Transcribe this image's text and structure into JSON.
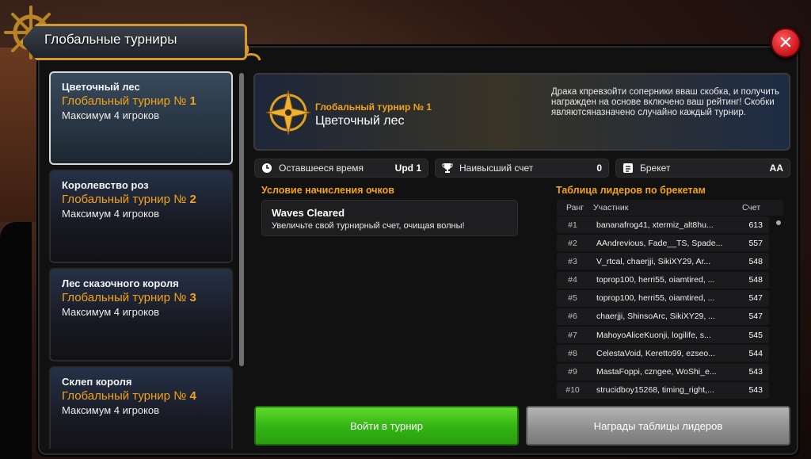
{
  "window": {
    "title": "Глобальные турниры"
  },
  "tournaments": [
    {
      "name": "Цветочный лес",
      "label": "Глобальный турнир №",
      "number": "1",
      "max": "Максимум 4 игроков"
    },
    {
      "name": "Королевство роз",
      "label": "Глобальный турнир №",
      "number": "2",
      "max": "Максимум 4 игроков"
    },
    {
      "name": "Лес сказочного короля",
      "label": "Глобальный турнир №",
      "number": "3",
      "max": "Максимум 4 игроков"
    },
    {
      "name": "Склеп короля",
      "label": "Глобальный турнир №",
      "number": "4",
      "max": "Максимум 4 игроков"
    }
  ],
  "hero": {
    "label": "Глобальный турнир № 1",
    "name": "Цветочный лес",
    "description": "Драка кпревзойти соперники вваш скобка, и получить награжден на основе включено ваш рейтинг! Скобки являютсяназначено случайно каждый турнир."
  },
  "stats": {
    "time": {
      "label": "Оставшееся время",
      "value": "Upd 1"
    },
    "highscore": {
      "label": "Наивысший счет",
      "value": "0"
    },
    "bracket": {
      "label": "Брекет",
      "value": "AA"
    }
  },
  "scoring": {
    "title": "Условие начисления очков",
    "condition_title": "Waves Cleared",
    "condition_desc": "Увеличьте свой турнирный счет, очищая волны!"
  },
  "leaderboard": {
    "title": "Таблица лидеров по брекетам",
    "col_rank": "Ранг",
    "col_participant": "Участник",
    "col_score": "Счет",
    "rows": [
      {
        "rank": "#1",
        "name": "bananafrog41, xtermiz_alt8hu...",
        "score": "613"
      },
      {
        "rank": "#2",
        "name": "AAndrevious, Fade__TS, Spade...",
        "score": "557"
      },
      {
        "rank": "#3",
        "name": "V_rtcal, chaerjji, SikiXY29, Ar...",
        "score": "548"
      },
      {
        "rank": "#4",
        "name": "toprop100, herri55, oiamtired, ...",
        "score": "548"
      },
      {
        "rank": "#5",
        "name": "toprop100, herri55, oiamtired, ...",
        "score": "547"
      },
      {
        "rank": "#6",
        "name": "chaerjji, ShinsoArc, SikiXY29, ...",
        "score": "547"
      },
      {
        "rank": "#7",
        "name": "MahoyoAliceKuonji, logilife, s...",
        "score": "545"
      },
      {
        "rank": "#8",
        "name": "CelestaVoid, Keretto99, ezseo...",
        "score": "544"
      },
      {
        "rank": "#9",
        "name": "MastaFoppi, czngee, WoShi_e...",
        "score": "543"
      },
      {
        "rank": "#10",
        "name": "strucidboy15268, timing_right,...",
        "score": "543"
      }
    ]
  },
  "buttons": {
    "enter": "Войти в турнир",
    "rewards": "Награды таблицы лидеров"
  },
  "colors": {
    "gold": "#f2a318",
    "enter_green": "#32b314",
    "close_red": "#c8141c"
  }
}
